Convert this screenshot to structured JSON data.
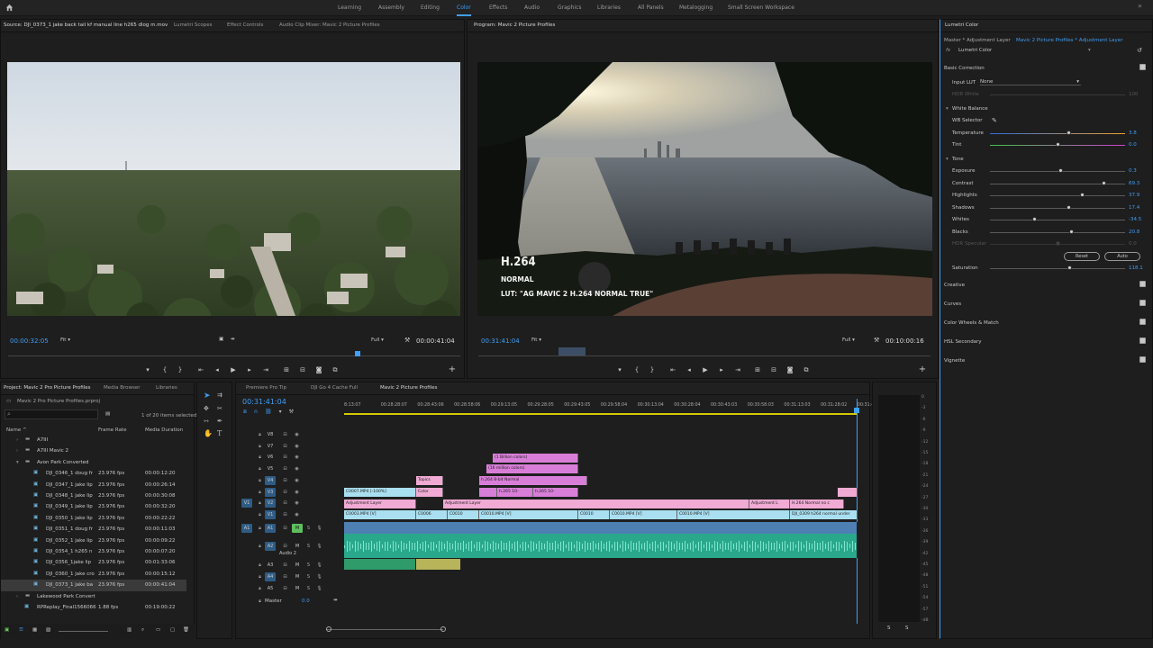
{
  "workspaces": [
    "Learning",
    "Assembly",
    "Editing",
    "Color",
    "Effects",
    "Audio",
    "Graphics",
    "Libraries",
    "All Panels",
    "Metalogging",
    "Small Screen Workspace"
  ],
  "source": {
    "tabs": [
      "Source: DJI_0373_1 jake back tail kf manual line h265 dlog m.mov",
      "Lumetri Scopes",
      "Effect Controls",
      "Audio Clip Mixer: Mavic 2 Picture Profiles"
    ],
    "timecode": "00:00:32:05",
    "zoom": "Fit",
    "resolution": "Full",
    "duration": "00:00:41:04"
  },
  "program": {
    "tab": "Program: Mavic 2 Picture Profiles",
    "timecode": "00:31:41:04",
    "zoom": "Fit",
    "resolution": "Full",
    "duration": "00:10:00:16",
    "overlay": {
      "line1": "H.264",
      "line2": "NORMAL",
      "line3": "LUT: \"AG MAVIC 2 H.264 NORMAL TRUE\""
    }
  },
  "lumetri": {
    "title": "Lumetri Color",
    "breadcrumb_master": "Master * Adjustment Layer",
    "breadcrumb_seq": "Mavic 2 Picture Profiles * Adjustment Layer",
    "fx_name": "Lumetri Color",
    "basic_correction": "Basic Correction",
    "input_lut_label": "Input LUT",
    "input_lut_value": "None",
    "hdr_white_label": "HDR White",
    "hdr_white_value": "100",
    "white_balance": "White Balance",
    "wb_selector": "WB Selector",
    "tone": "Tone",
    "sliders": [
      {
        "name": "Temperature",
        "value": "3.8",
        "pos": 0.58,
        "kind": "temp"
      },
      {
        "name": "Tint",
        "value": "0.0",
        "pos": 0.5,
        "kind": "tint"
      },
      {
        "name": "Exposure",
        "value": "0.3",
        "pos": 0.52
      },
      {
        "name": "Contrast",
        "value": "69.3",
        "pos": 0.84
      },
      {
        "name": "Highlights",
        "value": "37.9",
        "pos": 0.68
      },
      {
        "name": "Shadows",
        "value": "17.4",
        "pos": 0.58
      },
      {
        "name": "Whites",
        "value": "-34.5",
        "pos": 0.33
      },
      {
        "name": "Blacks",
        "value": "20.8",
        "pos": 0.6
      },
      {
        "name": "HDR Specular",
        "value": "0.0",
        "pos": 0.5,
        "disabled": true
      }
    ],
    "reset": "Reset",
    "auto": "Auto",
    "saturation_label": "Saturation",
    "saturation_value": "118.1",
    "saturation_pos": 0.59,
    "sections": [
      "Creative",
      "Curves",
      "Color Wheels & Match",
      "HSL Secondary",
      "Vignette"
    ]
  },
  "project": {
    "tabs": [
      "Project: Mavic 2 Pro Picture Profiles",
      "Media Browser",
      "Libraries"
    ],
    "file": "Mavic 2 Pro Picture Profiles.prproj",
    "selection": "1 of 20 items selected",
    "columns": [
      "Name",
      "Frame Rate",
      "Media Duration"
    ],
    "items": [
      {
        "name": "A7III",
        "rate": "",
        "dur": "",
        "type": "bin",
        "indent": 1
      },
      {
        "name": "A7III Mavic 2",
        "rate": "",
        "dur": "",
        "type": "bin",
        "indent": 1
      },
      {
        "name": "Avon Park Converted",
        "rate": "",
        "dur": "",
        "type": "bin",
        "indent": 1,
        "open": true
      },
      {
        "name": "DJI_0346_1 doug fr",
        "rate": "23.976 fps",
        "dur": "00:00:12:20",
        "type": "clip",
        "indent": 2
      },
      {
        "name": "DJI_0347_1 jake lip",
        "rate": "23.976 fps",
        "dur": "00:00:26:14",
        "type": "clip",
        "indent": 2
      },
      {
        "name": "DJI_0348_1 jake lip",
        "rate": "23.976 fps",
        "dur": "00:00:30:08",
        "type": "clip",
        "indent": 2
      },
      {
        "name": "DJI_0349_1 jake lip",
        "rate": "23.976 fps",
        "dur": "00:00:32:20",
        "type": "clip",
        "indent": 2
      },
      {
        "name": "DJI_0350_1 jake lip",
        "rate": "23.976 fps",
        "dur": "00:00:22:22",
        "type": "clip",
        "indent": 2
      },
      {
        "name": "DJI_0351_1 doug fr",
        "rate": "23.976 fps",
        "dur": "00:00:11:03",
        "type": "clip",
        "indent": 2
      },
      {
        "name": "DJI_0352_1 jake lip",
        "rate": "23.976 fps",
        "dur": "00:00:09:22",
        "type": "clip",
        "indent": 2
      },
      {
        "name": "DJI_0354_1 h265 n",
        "rate": "23.976 fps",
        "dur": "00:00:07:20",
        "type": "clip",
        "indent": 2
      },
      {
        "name": "DJI_0356_1jake lip",
        "rate": "23.976 fps",
        "dur": "00:01:33:06",
        "type": "clip",
        "indent": 2
      },
      {
        "name": "DJI_0360_1 jake cro",
        "rate": "23.976 fps",
        "dur": "00:00:15:12",
        "type": "clip",
        "indent": 2
      },
      {
        "name": "DJI_0373_1 jake ba",
        "rate": "23.976 fps",
        "dur": "00:00:41:04",
        "type": "clip",
        "indent": 2,
        "selected": true
      },
      {
        "name": "Lakewood Park Convert",
        "rate": "",
        "dur": "",
        "type": "bin",
        "indent": 1
      },
      {
        "name": "RPReplay_Final1566066",
        "rate": "1.88 fps",
        "dur": "00:19:00:22",
        "type": "clip",
        "indent": 1
      }
    ]
  },
  "timeline": {
    "tabs": [
      "Premiere Pro Tip",
      "DJI Go 4 Cache Full",
      "Mavic 2 Picture Profiles"
    ],
    "timecode": "00:31:41:04",
    "ruler": [
      "8:13:07",
      "00:28:28:07",
      "00:28:43:06",
      "00:28:58:06",
      "00:29:13:05",
      "00:29:28:05",
      "00:29:43:05",
      "00:29:58:04",
      "00:30:13:04",
      "00:30:28:04",
      "00:30:43:03",
      "00:30:58:03",
      "00:31:13:03",
      "00:31:28:02",
      "00:31:43:0"
    ],
    "video_tracks": [
      "V8",
      "V7",
      "V6",
      "V5",
      "V4",
      "V3",
      "V2",
      "V1"
    ],
    "audio_tracks": [
      "A1",
      "A2",
      "A3",
      "A4",
      "A5"
    ],
    "audio2_name": "Audio 2",
    "master_label": "Master",
    "master_value": "0.0",
    "clips": {
      "billion": "(1 Billion colors)",
      "million": "(16 million colors)",
      "h264_8bit": "h.264 8-bit Normal",
      "h265_10": "h.265 10-",
      "h265_10b": "h.265 10-",
      "topics": "Topics",
      "color": "Color",
      "c0007": "C0007.MP4 [-100%]",
      "adj1": "Adjustment Layer",
      "adj2": "Adjustment Layer",
      "adj3": "Adjustment L",
      "h264norm": "H.264 Normal no c",
      "c0003": "C0003.MP4 [V]",
      "c0006": "C0006",
      "c0010a": "C0010",
      "c0010b": "C0010.MP4 [V]",
      "c0010c": "C0010",
      "c0010d": "C0010.MP4 [V]",
      "c0010e": "C0010.MP4 [V]",
      "dji0309": "DJI_0309 h264 normal under"
    }
  },
  "meter": {
    "scale": [
      "0",
      "-3",
      "-6",
      "-9",
      "-12",
      "-15",
      "-18",
      "-21",
      "-24",
      "-27",
      "-30",
      "-33",
      "-36",
      "-39",
      "-42",
      "-45",
      "-48",
      "-51",
      "-54",
      "-57",
      "-dB"
    ],
    "solo": [
      "S",
      "S"
    ]
  },
  "accent": "#3f9ef5"
}
